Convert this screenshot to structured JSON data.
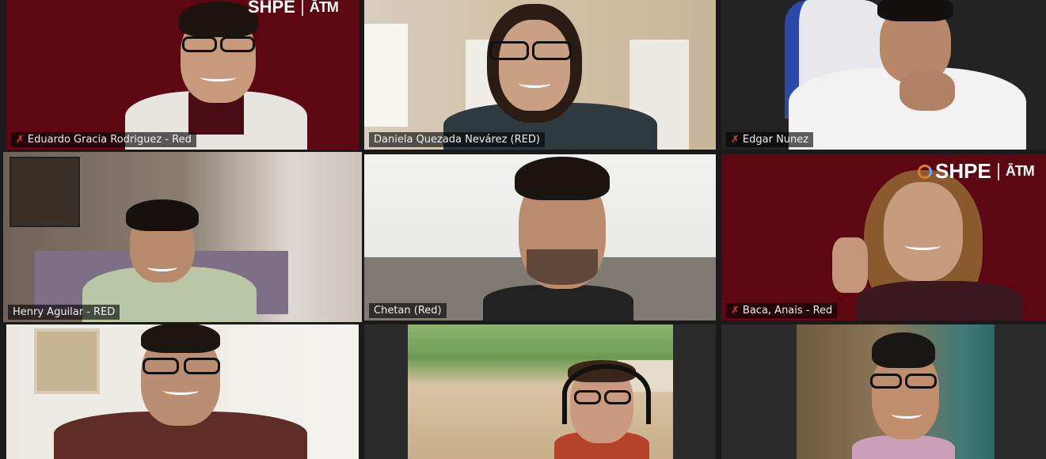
{
  "participants": [
    {
      "name": "Eduardo Gracia Rodriguez - Red",
      "muted": true
    },
    {
      "name": "Daniela Quezada Nevárez (RED)",
      "muted": false
    },
    {
      "name": "Edgar Nunez",
      "muted": true
    },
    {
      "name": "Henry Aguilar - RED",
      "muted": false,
      "active_speaker": true
    },
    {
      "name": "Chetan (Red)",
      "muted": false
    },
    {
      "name": "Baca, Anais - Red",
      "muted": true
    },
    {
      "name": "",
      "muted": false
    },
    {
      "name": "",
      "muted": false
    },
    {
      "name": "",
      "muted": false
    }
  ],
  "logo": {
    "text": "SHPE",
    "secondary": "ĀTM"
  },
  "icons": {
    "muted": "mic-muted-icon"
  },
  "colors": {
    "maroon": "#5a0711",
    "speaker_highlight": "#d6e34a",
    "muted_red": "#e23b3b"
  }
}
